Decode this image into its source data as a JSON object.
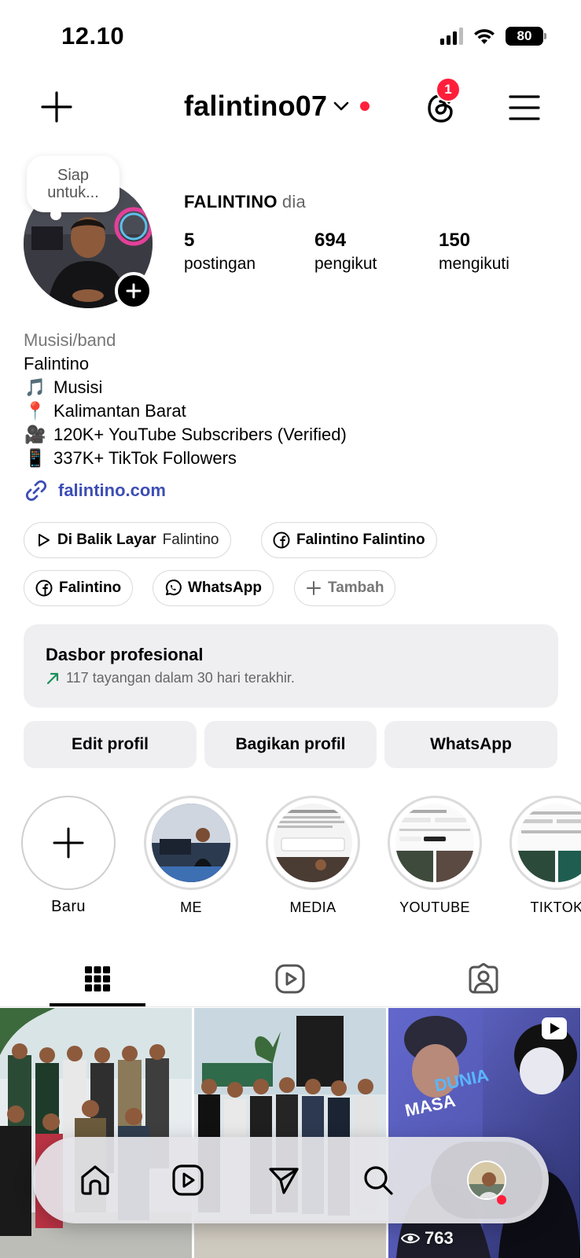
{
  "status_bar": {
    "time": "12.10",
    "battery": "80"
  },
  "header": {
    "username": "falintino07",
    "threads_badge": "1"
  },
  "profile": {
    "note": "Siap untuk...",
    "display_name": "FALINTINO",
    "pronoun": "dia",
    "stats": [
      {
        "value": "5",
        "label": "postingan"
      },
      {
        "value": "694",
        "label": "pengikut"
      },
      {
        "value": "150",
        "label": "mengikuti"
      }
    ],
    "category": "Musisi/band",
    "bio_name": "Falintino",
    "bio_lines": [
      {
        "emoji": "🎵",
        "text": "Musisi"
      },
      {
        "emoji": "📍",
        "text": "Kalimantan Barat"
      },
      {
        "emoji": "🎥",
        "text": "120K+ YouTube Subscribers (Verified)"
      },
      {
        "emoji": "📱",
        "text": "337K+ TikTok Followers"
      }
    ],
    "link": "falintino.com"
  },
  "chips": {
    "behind_scenes": {
      "title": "Di Balik Layar",
      "sub": "Falintino"
    },
    "facebook_page": "Falintino Falintino",
    "facebook": "Falintino",
    "whatsapp": "WhatsApp",
    "add": "Tambah"
  },
  "dashboard": {
    "title": "Dasbor profesional",
    "subtitle": "117 tayangan dalam 30 hari terakhir."
  },
  "actions": {
    "edit": "Edit profil",
    "share": "Bagikan profil",
    "whatsapp": "WhatsApp"
  },
  "highlights": {
    "new": "Baru",
    "items": [
      "ME",
      "MEDIA",
      "YOUTUBE",
      "TIKTOK"
    ]
  },
  "grid": {
    "reel_views": "763",
    "reel_text_1": "DUNIA",
    "reel_text_2": "MASA"
  },
  "colors": {
    "accent_red": "#ff1f3b",
    "link_blue": "#3d4eb5",
    "surface_gray": "#efeff2"
  }
}
